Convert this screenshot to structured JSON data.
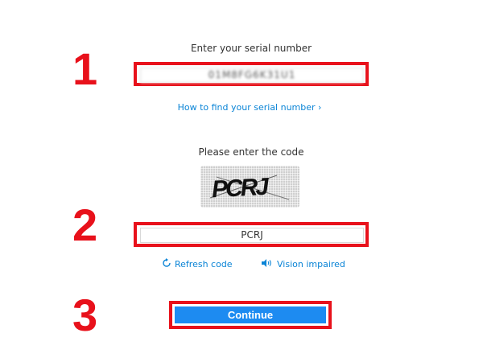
{
  "steps": [
    "1",
    "2",
    "3"
  ],
  "serial": {
    "label": "Enter your serial number",
    "value": "01M8FG6K31U1",
    "find_link": "How to find your serial number ›"
  },
  "captcha": {
    "label": "Please enter the code",
    "image_text": "PCRJ",
    "input_value": "PCRJ",
    "refresh_label": "Refresh code",
    "vision_label": "Vision impaired"
  },
  "continue_label": "Continue",
  "icons": {
    "refresh": "refresh-icon",
    "speaker": "speaker-icon"
  },
  "colors": {
    "highlight": "#e8111b",
    "link": "#0a84d6",
    "button": "#1d8bf1"
  }
}
